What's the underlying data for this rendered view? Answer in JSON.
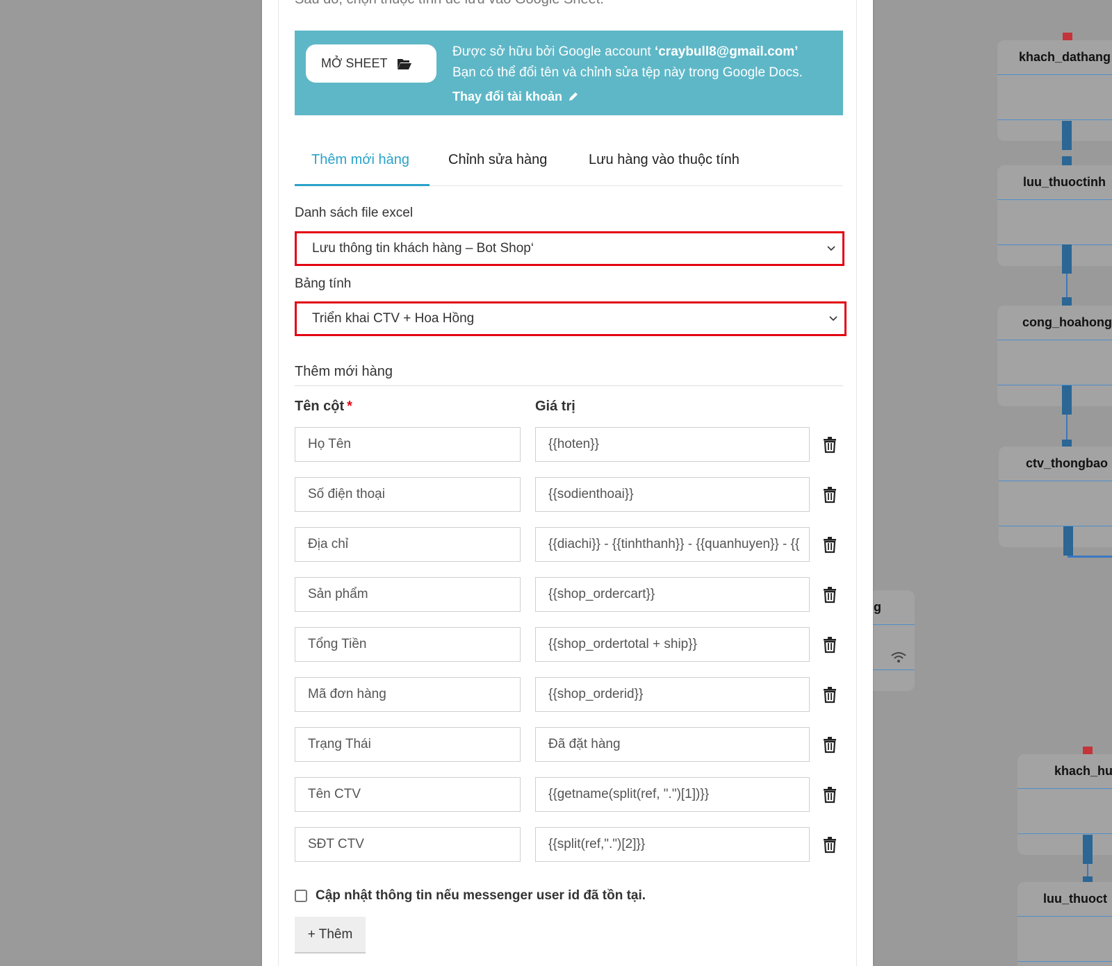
{
  "background_flow": {
    "nodes": [
      {
        "title": "khach_dathang"
      },
      {
        "title": "luu_thuoctinh"
      },
      {
        "title": "cong_hoahong"
      },
      {
        "title": "ctv_thongbao"
      },
      {
        "title": "g"
      },
      {
        "title": "khach_hu"
      },
      {
        "title": "luu_thuoct"
      }
    ]
  },
  "modal": {
    "intro_text": "Sau đó, chọn thuộc tính để lưu vào Google Sheet.",
    "sheet": {
      "open_button_label": "MỞ SHEET",
      "owner_prefix": "Được sở hữu bởi Google account ",
      "owner_email": "‘craybull8@gmail.com’",
      "rename_hint": "Bạn có thể đổi tên và chỉnh sửa tệp này trong Google Docs.",
      "change_account_label": "Thay đổi tài khoản"
    },
    "tabs": [
      {
        "label": "Thêm mới hàng",
        "active": true
      },
      {
        "label": "Chỉnh sửa hàng",
        "active": false
      },
      {
        "label": "Lưu hàng vào thuộc tính",
        "active": false
      }
    ],
    "file_list": {
      "label": "Danh sách file excel",
      "selected": "Lưu thông tin khách hàng – Bot Shop‘"
    },
    "spreadsheet": {
      "label": "Bảng tính",
      "selected": "Triển khai CTV + Hoa Hồng"
    },
    "add_row_section": {
      "title": "Thêm mới hàng",
      "col_name_header": "Tên cột",
      "required_mark": "*",
      "col_value_header": "Giá trị",
      "rows": [
        {
          "name": "Họ Tên",
          "value": "{{hoten}}"
        },
        {
          "name": "Số điện thoại",
          "value": "{{sodienthoai}}"
        },
        {
          "name": "Địa chỉ",
          "value": "{{diachi}} - {{tinhthanh}} - {{quanhuyen}} - {{"
        },
        {
          "name": "Sản phẩm",
          "value": "{{shop_ordercart}}"
        },
        {
          "name": "Tổng Tiền",
          "value": "{{shop_ordertotal + ship}}"
        },
        {
          "name": "Mã đơn hàng",
          "value": "{{shop_orderid}}"
        },
        {
          "name": "Trạng Thái",
          "value": "Đã đặt hàng"
        },
        {
          "name": "Tên CTV",
          "value": "{{getname(split(ref, \".\")[1])}}"
        },
        {
          "name": "SĐT CTV",
          "value": "{{split(ref,\".\")[2]}}"
        }
      ]
    },
    "update_checkbox_label": "Cập nhật thông tin nếu messenger user id đã tồn tại.",
    "add_button_label": "+ Thêm"
  },
  "colors": {
    "accent": "#2aa2c9",
    "sheet_banner": "#5eb7c7",
    "highlight_border": "#e30613",
    "connector": "#2b6694"
  }
}
